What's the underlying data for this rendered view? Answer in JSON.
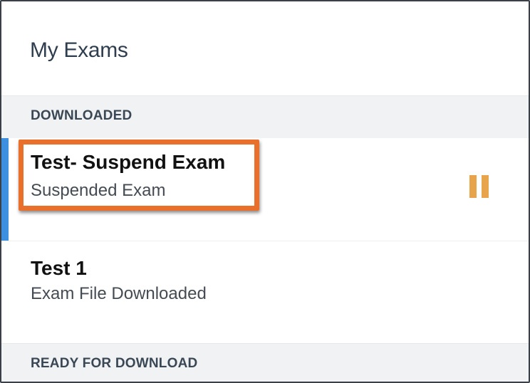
{
  "header": {
    "title": "My Exams"
  },
  "sections": {
    "downloaded": {
      "label": "DOWNLOADED",
      "exams": [
        {
          "title": "Test- Suspend Exam",
          "status": "Suspended Exam",
          "icon": "pause-icon"
        },
        {
          "title": "Test 1",
          "status": "Exam File Downloaded"
        }
      ]
    },
    "ready": {
      "label": "READY FOR DOWNLOAD"
    }
  },
  "colors": {
    "selected_accent": "#3d8fe0",
    "highlight": "#e8702a",
    "pause_icon": "#e8a44a"
  }
}
